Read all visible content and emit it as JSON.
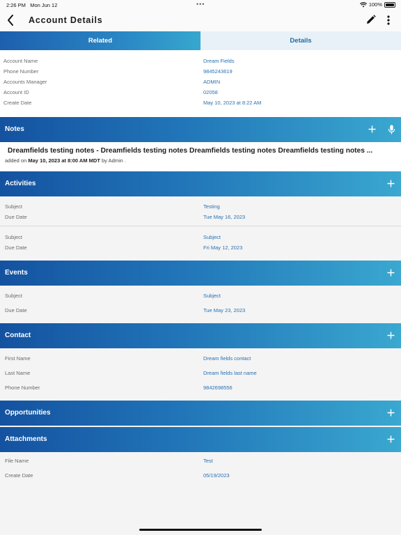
{
  "status_bar": {
    "time": "2:26 PM",
    "date": "Mon Jun 12",
    "dots": "•••",
    "battery": "100%"
  },
  "nav": {
    "title": "Account Details"
  },
  "tabs": {
    "related": "Related",
    "details": "Details"
  },
  "account": {
    "rows": [
      {
        "label": "Account Name",
        "value": "Dream Fields"
      },
      {
        "label": "Phone Number",
        "value": "9845243619"
      },
      {
        "label": "Accounts Manager",
        "value": "ADMIN"
      },
      {
        "label": "Account ID",
        "value": "02058"
      },
      {
        "label": "Create Date",
        "value": "May 10, 2023 at 8:22 AM"
      }
    ]
  },
  "notes": {
    "title": "Notes",
    "note_text": "Dreamfields testing notes - Dreamfields testing notes Dreamfields testing notes Dreamfields testing notes ...",
    "meta_prefix": "added on",
    "meta_date": "May 10, 2023 at 8:00 AM MDT",
    "meta_by": "by",
    "meta_author": "Admin",
    "meta_suffix": "."
  },
  "activities": {
    "title": "Activities",
    "items": [
      {
        "subject_label": "Subject",
        "subject": "Testing",
        "due_label": "Due Date",
        "due": "Tue May 16, 2023"
      },
      {
        "subject_label": "Subject",
        "subject": "Subject",
        "due_label": "Due Date",
        "due": "Fri May 12, 2023"
      }
    ]
  },
  "events": {
    "title": "Events",
    "subject_label": "Subject",
    "subject": "Subject",
    "due_label": "Due Date",
    "due": "Tue May 23, 2023"
  },
  "contact": {
    "title": "Contact",
    "rows": [
      {
        "label": "First Name",
        "value": "Dream fields contact"
      },
      {
        "label": "Last Name",
        "value": "Dream fields last name"
      },
      {
        "label": "Phone Number",
        "value": "9842698556"
      }
    ]
  },
  "opportunities": {
    "title": "Opportunities"
  },
  "attachments": {
    "title": "Attachments",
    "rows": [
      {
        "label": "File Name",
        "value": "Test"
      },
      {
        "label": "Create Date",
        "value": "05/19/2023"
      }
    ]
  },
  "colors": {
    "accent": "#2871b0",
    "header_start": "#1452a0",
    "header_end": "#3aa8d0"
  },
  "icons": [
    "back-chevron-icon",
    "edit-pencil-icon",
    "more-vertical-icon",
    "plus-icon",
    "microphone-icon",
    "wifi-icon",
    "battery-icon"
  ]
}
